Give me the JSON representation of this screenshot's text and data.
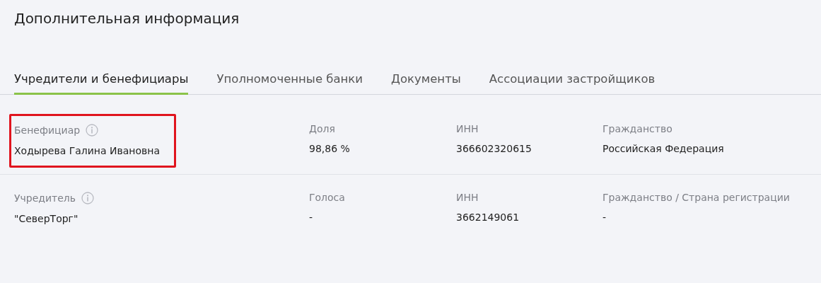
{
  "title": "Дополнительная информация",
  "tabs": [
    {
      "label": "Учредители и бенефициары",
      "selected": true
    },
    {
      "label": "Уполномоченные банки",
      "selected": false
    },
    {
      "label": "Документы",
      "selected": false
    },
    {
      "label": "Ассоциации застройщиков",
      "selected": false
    }
  ],
  "sections": [
    {
      "highlighted": true,
      "columns": [
        {
          "label": "Бенефициар",
          "info": true,
          "value": "Ходырева Галина Ивановна"
        },
        {
          "label": "Доля",
          "info": false,
          "value": "98,86 %"
        },
        {
          "label": "ИНН",
          "info": false,
          "value": "366602320615"
        },
        {
          "label": "Гражданство",
          "info": false,
          "value": "Российская Федерация"
        }
      ]
    },
    {
      "highlighted": false,
      "columns": [
        {
          "label": "Учредитель",
          "info": true,
          "value": "\"СеверТорг\""
        },
        {
          "label": "Голоса",
          "info": false,
          "value": "-"
        },
        {
          "label": "ИНН",
          "info": false,
          "value": "3662149061"
        },
        {
          "label": "Гражданство / Страна регистрации",
          "info": false,
          "value": "-"
        }
      ]
    }
  ]
}
